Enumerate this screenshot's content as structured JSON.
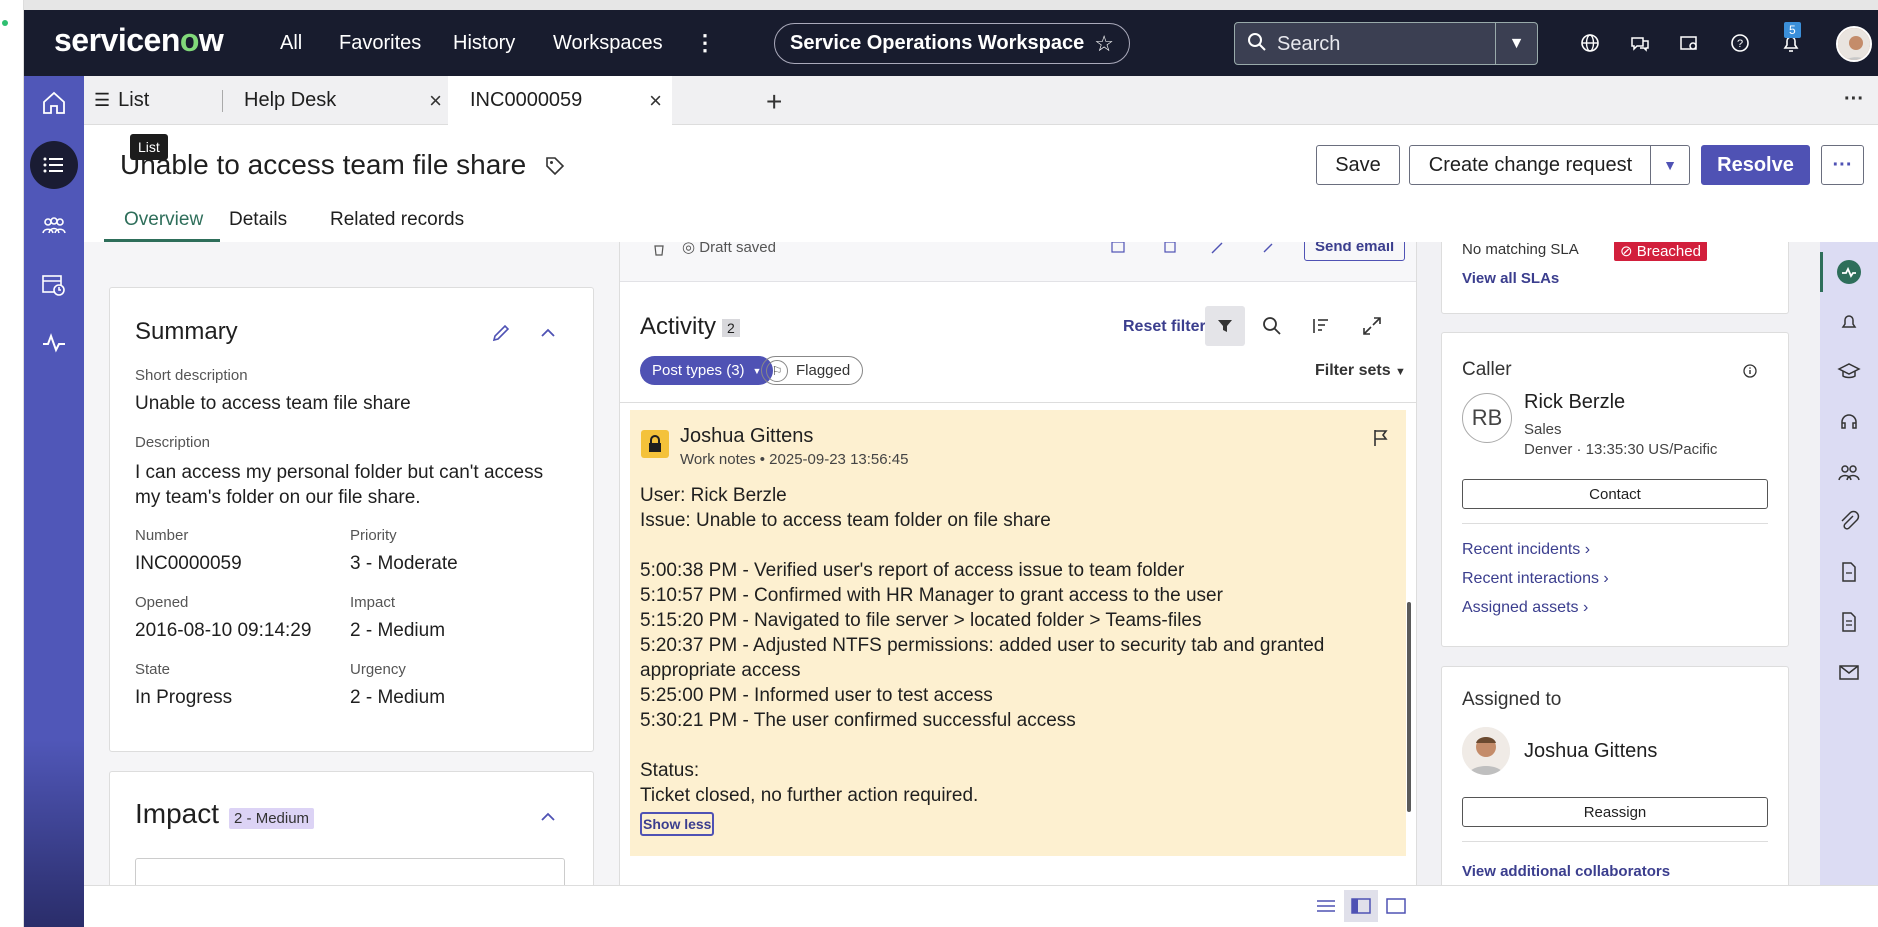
{
  "topbar": {
    "logo": "servicenow",
    "nav": [
      "All",
      "Favorites",
      "History",
      "Workspaces"
    ],
    "workspace_title": "Service Operations Workspace",
    "search_placeholder": "Search",
    "notification_count": "5"
  },
  "tabs": [
    {
      "label": "List"
    },
    {
      "label": "Help Desk"
    },
    {
      "label": "INC0000059"
    }
  ],
  "tooltip": "List",
  "record": {
    "title": "Unable to access team file share",
    "buttons": {
      "save": "Save",
      "change": "Create change request",
      "resolve": "Resolve"
    },
    "subtabs": [
      "Overview",
      "Details",
      "Related records"
    ]
  },
  "summary": {
    "title": "Summary",
    "short_description_label": "Short description",
    "short_description": "Unable to access team file share",
    "description_label": "Description",
    "description": "I can access my personal folder but can't access my team's folder on our file share.",
    "number_label": "Number",
    "number": "INC0000059",
    "priority_label": "Priority",
    "priority": "3 - Moderate",
    "opened_label": "Opened",
    "opened": "2016-08-10 09:14:29",
    "impact_label": "Impact",
    "impact": "2 - Medium",
    "state_label": "State",
    "state": "In Progress",
    "urgency_label": "Urgency",
    "urgency": "2 - Medium"
  },
  "impact_card": {
    "title": "Impact",
    "badge": "2 - Medium"
  },
  "activity": {
    "draft_status": "Draft saved",
    "send_email": "Send email",
    "title": "Activity",
    "count": "2",
    "reset_filter": "Reset filter",
    "post_types": "Post types (3)",
    "flagged": "Flagged",
    "filter_sets": "Filter sets",
    "entry": {
      "author": "Joshua Gittens",
      "meta": "Work notes • 2025-09-23 13:56:45",
      "body": "User: Rick Berzle\nIssue: Unable to access team folder on file share\n\n5:00:38 PM - Verified user's report of access issue to team folder\n5:10:57 PM - Confirmed with HR Manager to grant access to the user\n5:15:20 PM - Navigated to file server > located folder > Teams-files\n5:20:37 PM - Adjusted NTFS permissions: added user to security tab and granted appropriate access\n5:25:00 PM - Informed user to test access\n5:30:21 PM - The user confirmed successful access\n\nStatus:\nTicket closed, no further action required.",
      "show_less": "Show less"
    }
  },
  "sla": {
    "partial_text": "No matching SLA",
    "breached": "Breached",
    "view_all": "View all SLAs"
  },
  "caller": {
    "title": "Caller",
    "initials": "RB",
    "name": "Rick Berzle",
    "department": "Sales",
    "location": "Denver · 13:35:30 US/Pacific",
    "contact_button": "Contact",
    "links": [
      "Recent incidents",
      "Recent interactions",
      "Assigned assets"
    ]
  },
  "assigned": {
    "title": "Assigned to",
    "name": "Joshua Gittens",
    "reassign_button": "Reassign",
    "collaborators_link": "View additional collaborators"
  },
  "colors": {
    "topbar": "#181c2e",
    "sidenav": "#5057b8",
    "primary": "#4f52b4",
    "note_bg": "#fdf0d0",
    "breach": "#d21f3c"
  }
}
